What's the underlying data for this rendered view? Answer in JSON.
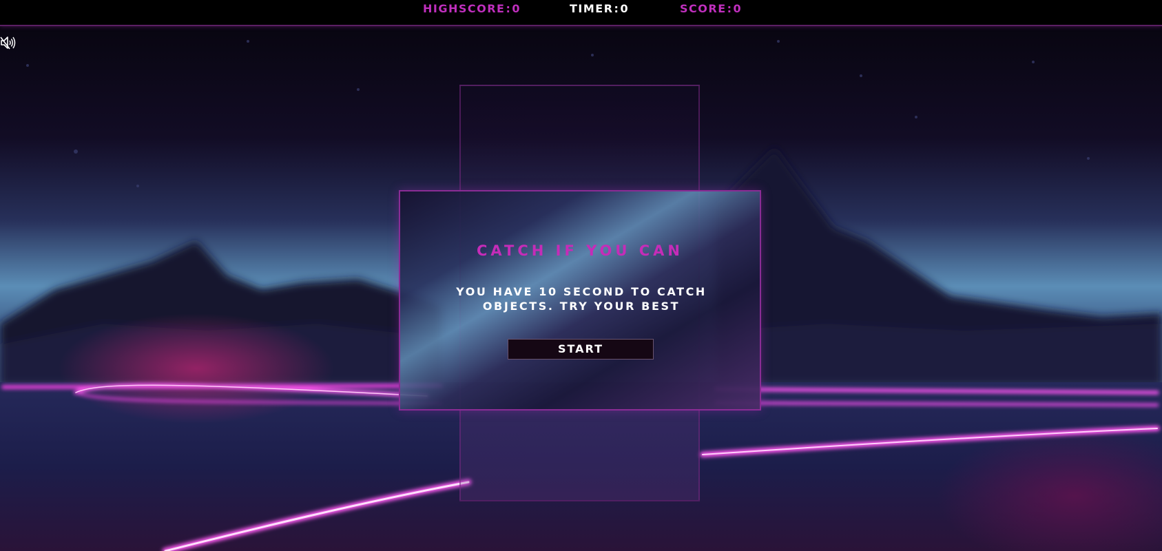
{
  "hud": {
    "highscore_label": "HIGHSCORE",
    "highscore_value": "0",
    "timer_label": "TIMER",
    "timer_value": "0",
    "score_label": "SCORE",
    "score_value": "0"
  },
  "sound": {
    "icon": "speaker-muted-icon"
  },
  "modal": {
    "title": "CATCH IF YOU CAN",
    "description": "YOU HAVE 10 SECOND TO CATCH OBJECTS. TRY YOUR BEST",
    "start_label": "START"
  },
  "colors": {
    "accent": "#c02fbe",
    "hud_background": "#000000",
    "button_background": "#150714"
  }
}
